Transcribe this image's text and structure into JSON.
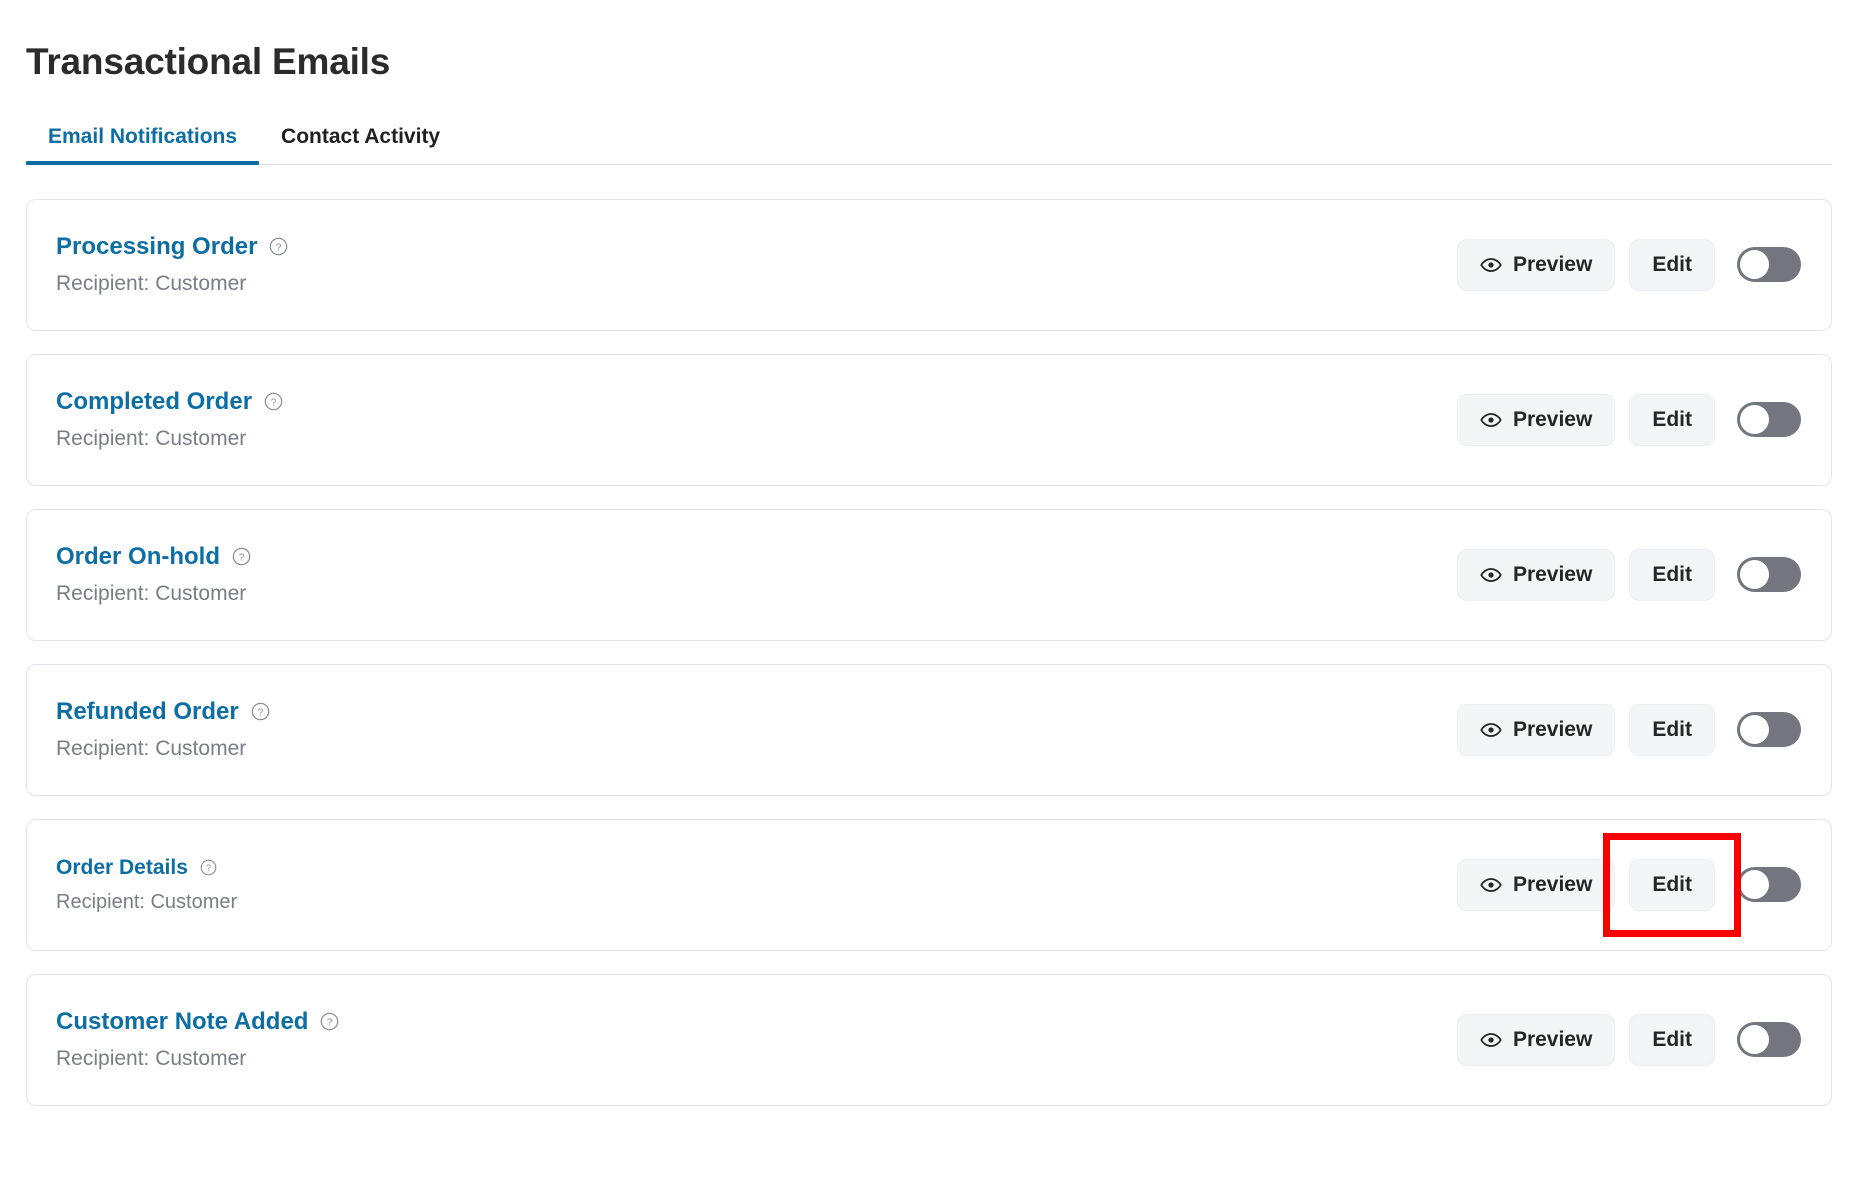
{
  "header": {
    "title": "Transactional Emails"
  },
  "tabs": [
    {
      "label": "Email Notifications",
      "active": true
    },
    {
      "label": "Contact Activity",
      "active": false
    }
  ],
  "actions": {
    "preview_label": "Preview",
    "edit_label": "Edit",
    "preview_icon": "eye-icon",
    "help_icon": "help-circle-icon",
    "toggle_state": "off"
  },
  "colors": {
    "link_blue": "#0c6ea4",
    "tab_active": "#0c6ea4",
    "title_text": "#2b2b2b",
    "sub_text": "#7a7d88",
    "button_bg": "#f4f5f6",
    "toggle_off_track": "#73757f",
    "toggle_knob": "#ffffff",
    "card_border": "#e3e4ea",
    "highlight": "#f90000"
  },
  "emails": [
    {
      "title": "Processing Order",
      "recipient": "Recipient: Customer",
      "toggle": "off",
      "highlighted": false,
      "compact": false
    },
    {
      "title": "Completed Order",
      "recipient": "Recipient: Customer",
      "toggle": "off",
      "highlighted": false,
      "compact": false
    },
    {
      "title": "Order On-hold",
      "recipient": "Recipient: Customer",
      "toggle": "off",
      "highlighted": false,
      "compact": false
    },
    {
      "title": "Refunded Order",
      "recipient": "Recipient: Customer",
      "toggle": "off",
      "highlighted": false,
      "compact": false
    },
    {
      "title": "Order Details",
      "recipient": "Recipient: Customer",
      "toggle": "off",
      "highlighted": true,
      "compact": true
    },
    {
      "title": "Customer Note Added",
      "recipient": "Recipient: Customer",
      "toggle": "off",
      "highlighted": false,
      "compact": false
    }
  ]
}
